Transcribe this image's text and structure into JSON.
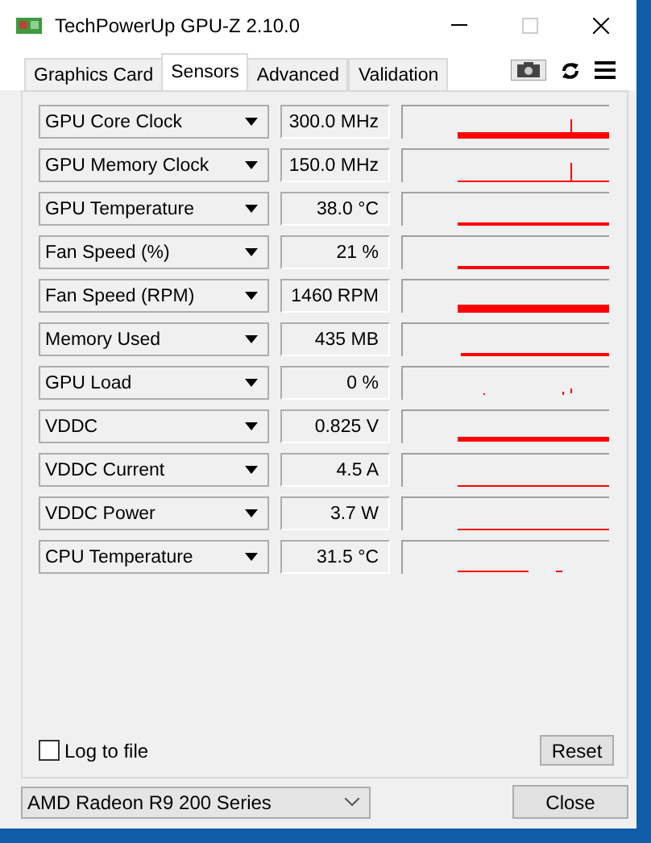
{
  "window": {
    "title": "TechPowerUp GPU-Z 2.10.0"
  },
  "tabs": [
    {
      "label": "Graphics Card",
      "selected": false
    },
    {
      "label": "Sensors",
      "selected": true
    },
    {
      "label": "Advanced",
      "selected": false
    },
    {
      "label": "Validation",
      "selected": false
    }
  ],
  "sensors": [
    {
      "name": "GPU Core Clock",
      "reading": "300.0 MHz"
    },
    {
      "name": "GPU Memory Clock",
      "reading": "150.0 MHz"
    },
    {
      "name": "GPU Temperature",
      "reading": "38.0 °C"
    },
    {
      "name": "Fan Speed (%)",
      "reading": "21 %"
    },
    {
      "name": "Fan Speed (RPM)",
      "reading": "1460 RPM"
    },
    {
      "name": "Memory Used",
      "reading": "435 MB"
    },
    {
      "name": "GPU Load",
      "reading": "0 %"
    },
    {
      "name": "VDDC",
      "reading": "0.825 V"
    },
    {
      "name": "VDDC Current",
      "reading": "4.5 A"
    },
    {
      "name": "VDDC Power",
      "reading": "3.7 W"
    },
    {
      "name": "CPU Temperature",
      "reading": "31.5 °C"
    }
  ],
  "log_to_file": {
    "label": "Log to file",
    "checked": false
  },
  "reset_button": "Reset",
  "gpu_select": {
    "value": "AMD Radeon R9 200 Series"
  },
  "close_button": "Close"
}
